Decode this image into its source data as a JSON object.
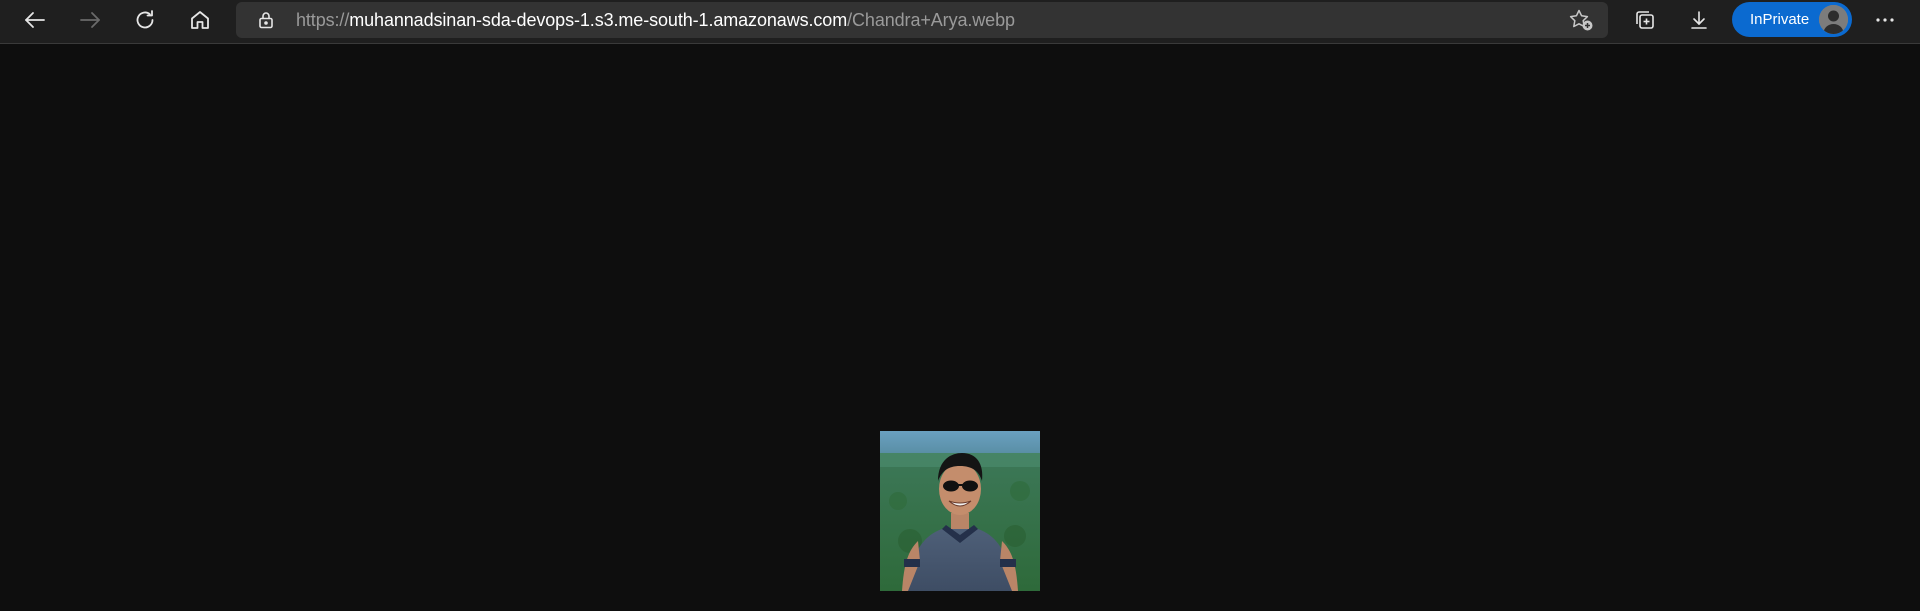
{
  "browser": {
    "url_scheme": "https://",
    "url_host": "muhannadsinan-sda-devops-1.s3.me-south-1.amazonaws.com",
    "url_path": "/Chandra+Arya.webp",
    "inprivate_label": "InPrivate"
  },
  "icons": {
    "back": "arrow-left-icon",
    "forward": "arrow-right-icon",
    "refresh": "refresh-icon",
    "home": "home-icon",
    "lock": "lock-icon",
    "favorite": "star-add-icon",
    "collections": "collections-icon",
    "downloads": "download-icon",
    "more": "more-icon"
  },
  "image": {
    "subject": "smiling man with sunglasses in front of a forest"
  },
  "colors": {
    "page_background": "#0e0e0e",
    "toolbar": "#1f1f1f",
    "addressbar": "#333333",
    "inprivate_accent": "#0b6ad0"
  }
}
